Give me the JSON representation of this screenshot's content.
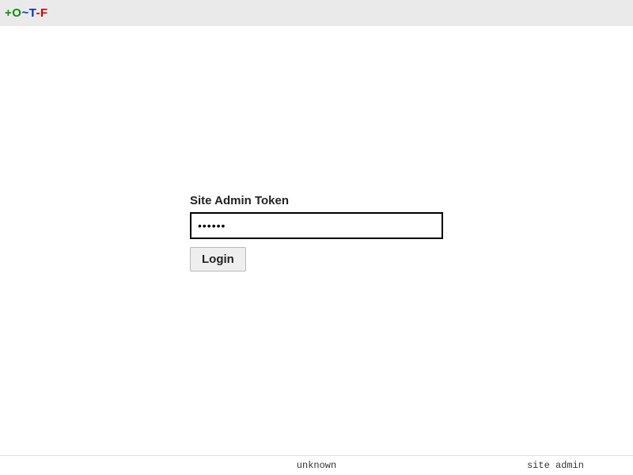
{
  "logo": {
    "plus": "+",
    "o": "O",
    "tilde": "~",
    "t": "T",
    "dash": "-",
    "f": "F"
  },
  "form": {
    "label": "Site Admin Token",
    "token_value": "••••••",
    "login_label": "Login"
  },
  "footer": {
    "center": "unknown",
    "right": "site admin"
  }
}
